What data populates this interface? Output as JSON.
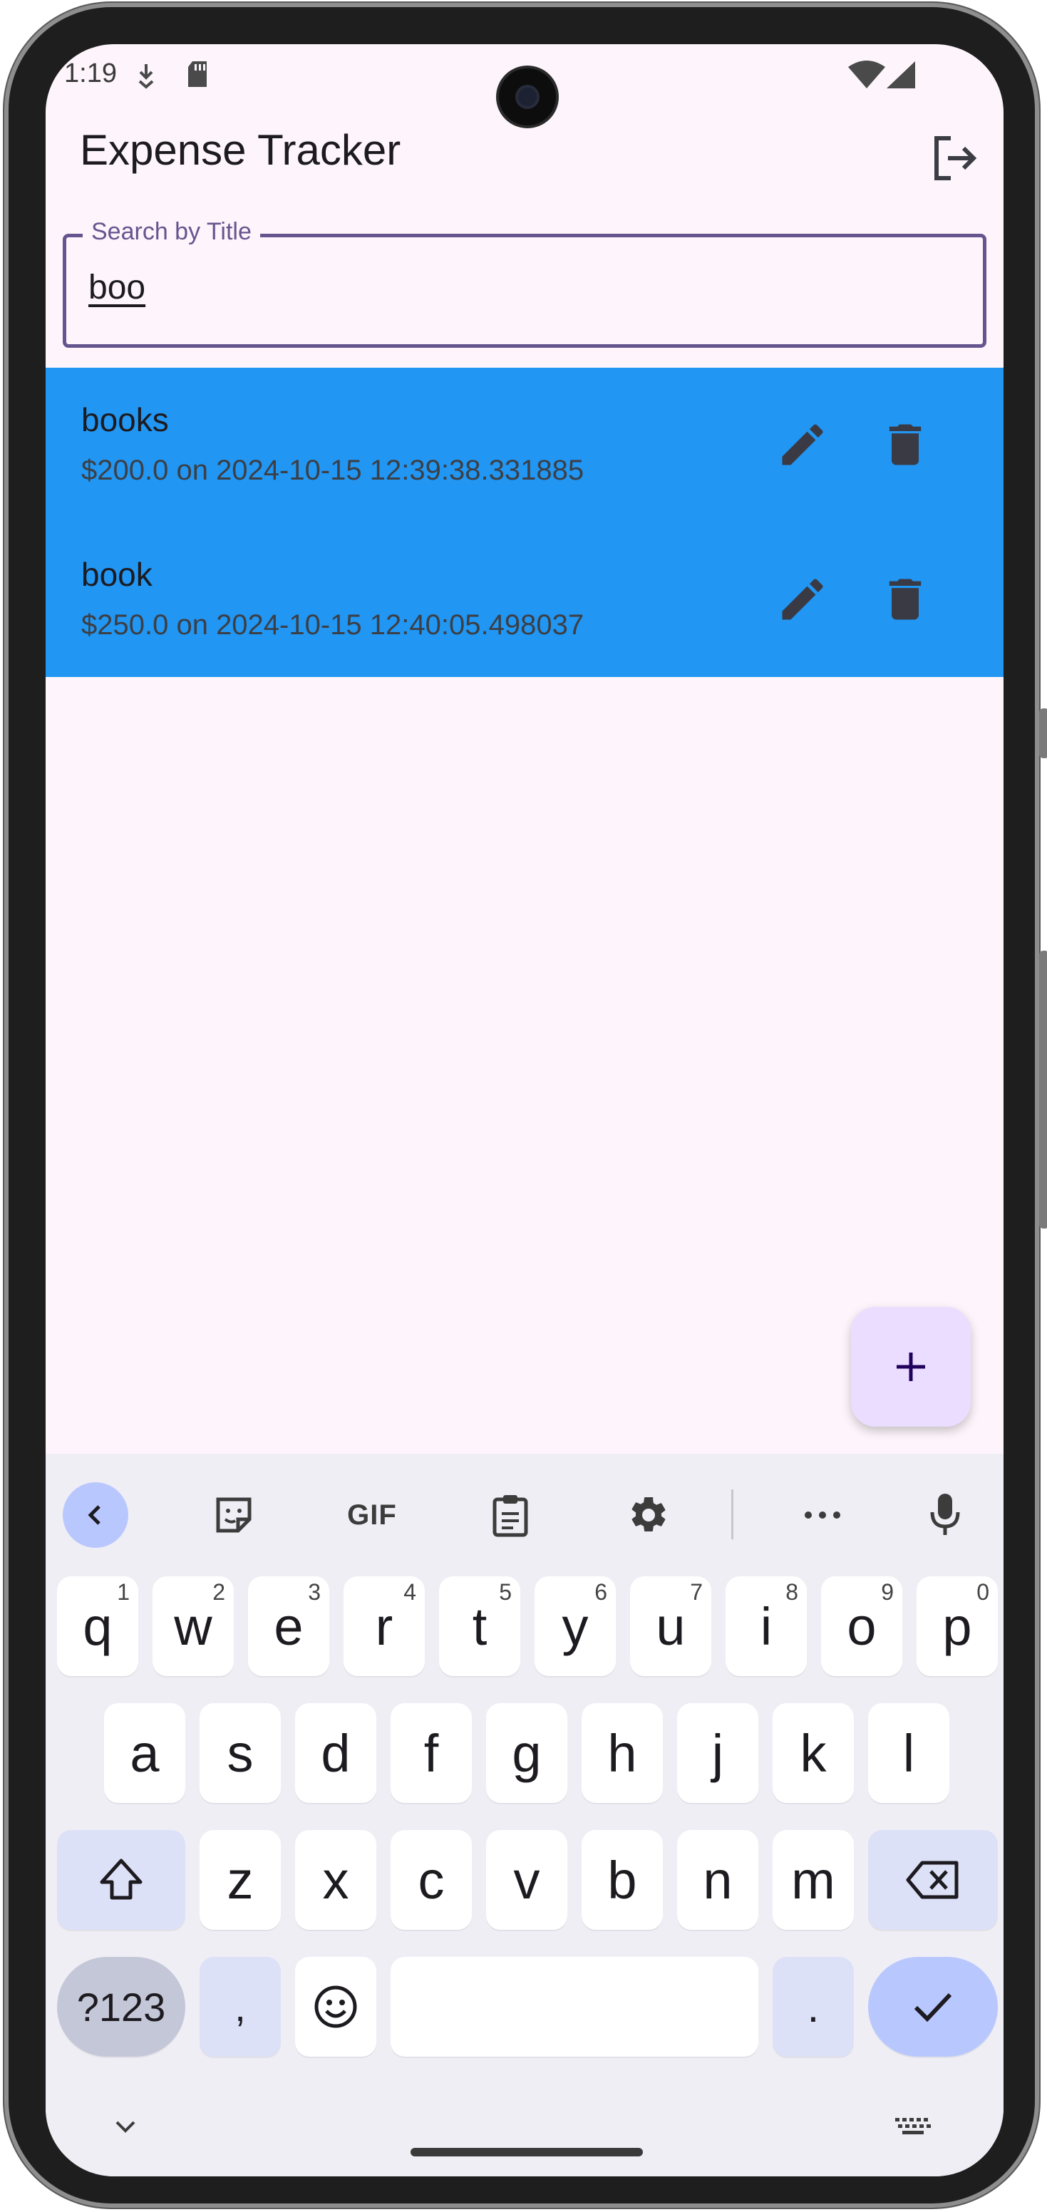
{
  "status": {
    "time": "1:19"
  },
  "app": {
    "title": "Expense Tracker",
    "logout_icon": "logout-icon"
  },
  "search": {
    "label": "Search by Title",
    "value": "boo"
  },
  "expenses": [
    {
      "title": "books",
      "subtitle": "$200.0 on 2024-10-15 12:39:38.331885"
    },
    {
      "title": "book",
      "subtitle": "$250.0 on 2024-10-15 12:40:05.498037"
    }
  ],
  "colors": {
    "list_bg": "#2196f3",
    "accent": "#65558f",
    "fab_bg": "#eaddff",
    "screen_bg": "#fdf5fb"
  },
  "fab": {
    "label": "+"
  },
  "keyboard": {
    "toolbar": {
      "gif": "GIF"
    },
    "row1": [
      {
        "k": "q",
        "h": "1"
      },
      {
        "k": "w",
        "h": "2"
      },
      {
        "k": "e",
        "h": "3"
      },
      {
        "k": "r",
        "h": "4"
      },
      {
        "k": "t",
        "h": "5"
      },
      {
        "k": "y",
        "h": "6"
      },
      {
        "k": "u",
        "h": "7"
      },
      {
        "k": "i",
        "h": "8"
      },
      {
        "k": "o",
        "h": "9"
      },
      {
        "k": "p",
        "h": "0"
      }
    ],
    "row2": [
      "a",
      "s",
      "d",
      "f",
      "g",
      "h",
      "j",
      "k",
      "l"
    ],
    "row3": [
      "z",
      "x",
      "c",
      "v",
      "b",
      "n",
      "m"
    ],
    "symbols": "?123",
    "comma": ",",
    "period": "."
  }
}
